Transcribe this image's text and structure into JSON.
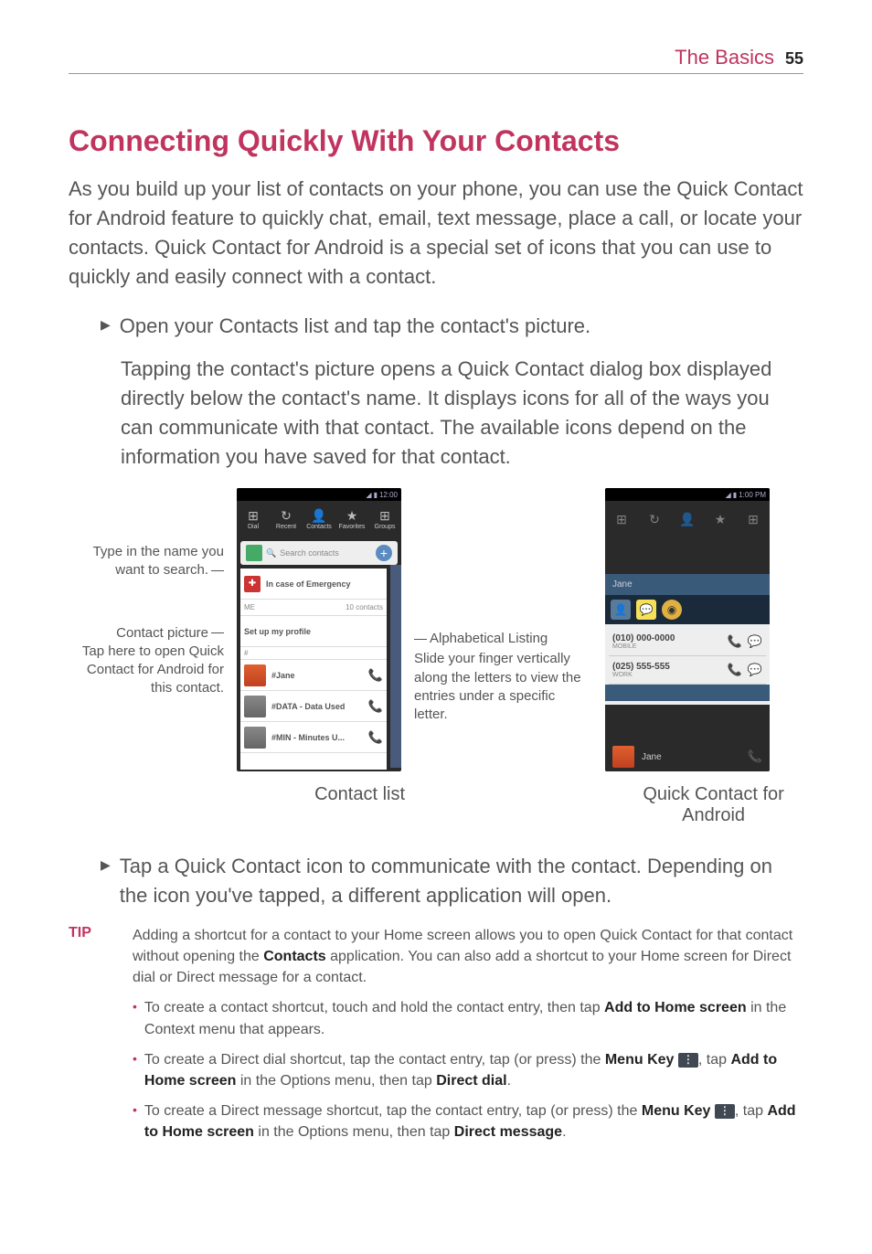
{
  "header": {
    "section": "The Basics",
    "page": "55"
  },
  "title": "Connecting Quickly With Your Contacts",
  "intro": "As you build up your list of contacts on your phone, you can use the Quick Contact for Android feature to quickly chat, email, text message, place a call, or locate your contacts. Quick Contact for Android is a special set of icons that you can use to quickly and easily connect with a contact.",
  "step1": "Open your Contacts list and tap the contact's picture.",
  "step1_para": "Tapping the contact's picture opens a Quick Contact dialog box displayed directly below the contact's name. It displays icons for all of the ways you can communicate with that contact. The available icons depend on the information you have saved for that contact.",
  "labels": {
    "search": "Type in the name you want to search.",
    "picture_title": "Contact picture",
    "picture_desc": "Tap here to open Quick Contact for Android for this contact.",
    "alpha_title": "Alphabetical Listing",
    "alpha_desc": "Slide your finger vertically along the letters to view the entries under a specific letter."
  },
  "phone1": {
    "time": "12:00",
    "tabs": [
      "Dial",
      "Recent",
      "Contacts",
      "Favorites",
      "Groups"
    ],
    "search_placeholder": "Search contacts",
    "rows": {
      "ice": "In case of Emergency",
      "me": "ME",
      "count": "10 contacts",
      "setup": "Set up my profile",
      "sep": "#",
      "jane": "#Jane",
      "data": "#DATA - Data Used",
      "min": "#MIN - Minutes U..."
    }
  },
  "phone2": {
    "time": "1:00 PM",
    "name": "Jane",
    "num1": "(010) 000-0000",
    "type1": "MOBILE",
    "num2": "(025) 555-555",
    "type2": "WORK",
    "bottom_name": "Jane"
  },
  "captions": {
    "left": "Contact list",
    "right": "Quick Contact for Android"
  },
  "step2": "Tap a Quick Contact icon to communicate with the contact. Depending on the icon you've tapped, a different application will open.",
  "tip": {
    "label": "TIP",
    "intro_a": "Adding a shortcut for a contact to your Home screen allows you to open Quick Contact for that contact without opening the ",
    "intro_b": "Contacts",
    "intro_c": " application. You can also add a shortcut to your Home screen for Direct dial or Direct message for a contact.",
    "b1_a": "To create a contact shortcut, touch and hold the contact entry, then tap ",
    "b1_b": "Add to Home screen",
    "b1_c": " in the Context menu that appears.",
    "b2_a": "To create a Direct dial shortcut, tap the contact entry, tap (or press) the ",
    "b2_b": "Menu Key",
    "b2_c": ", tap ",
    "b2_d": "Add to Home screen",
    "b2_e": " in the Options menu, then tap ",
    "b2_f": "Direct dial",
    "b2_g": ".",
    "b3_a": "To create a Direct message shortcut, tap the contact entry, tap (or press) the ",
    "b3_b": "Menu Key",
    "b3_c": ", tap ",
    "b3_d": "Add to Home screen",
    "b3_e": " in the Options menu, then tap ",
    "b3_f": "Direct message",
    "b3_g": "."
  }
}
